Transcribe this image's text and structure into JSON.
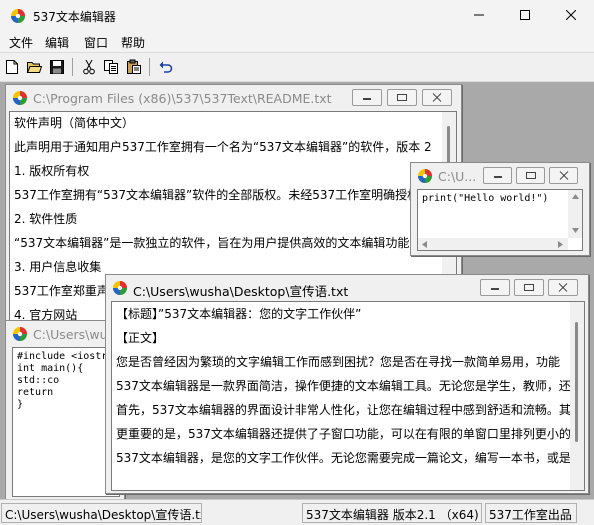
{
  "app": {
    "title": "537文本编辑器"
  },
  "menu": [
    "文件",
    "编辑",
    "窗口",
    "帮助"
  ],
  "toolbar": [
    "new-file-icon",
    "open-folder-icon",
    "save-icon",
    "cut-icon",
    "copy-icon",
    "paste-icon",
    "undo-icon"
  ],
  "windows": {
    "readme": {
      "title": "C:\\Program Files (x86)\\537\\537Text\\README.txt",
      "lines": [
        "软件声明（简体中文）",
        "此声明用于通知用户537工作室拥有一个名为“537文本编辑器”的软件，版本 2",
        "1. 版权所有权",
        "537工作室拥有“537文本编辑器”软件的全部版权。未经537工作室明确授权",
        "2. 软件性质",
        "“537文本编辑器”是一款独立的软件，旨在为用户提供高效的文本编辑功能",
        "3. 用户信息收集",
        "537工作室郑重声明",
        "4. 官方网站"
      ]
    },
    "hello": {
      "title": "C:\\U...",
      "lines": [
        "print(\"Hello world!\")"
      ]
    },
    "cpp": {
      "title": "C:\\Users\\wu",
      "lines": [
        "#include <iostr",
        "int main(){",
        "        std::co",
        "        return",
        "}"
      ]
    },
    "promo": {
      "title": "C:\\Users\\wusha\\Desktop\\宣传语.txt",
      "lines": [
        "【标题】”537文本编辑器：您的文字工作伙伴”",
        "【正文】",
        "您是否曾经因为繁琐的文字编辑工作而感到困扰？您是否在寻找一款简单易用，功能",
        "537文本编辑器是一款界面简洁，操作便捷的文本编辑工具。无论您是学生，教师，还",
        "首先，537文本编辑器的界面设计非常人性化，让您在编辑过程中感到舒适和流畅。其",
        "更重要的是，537文本编辑器还提供了子窗口功能，可以在有限的单窗口里排列更小的",
        "537文本编辑器，是您的文字工作伙伴。无论您需要完成一篇论文，编写一本书，或是"
      ]
    }
  },
  "status": {
    "path": "C:\\Users\\wusha\\Desktop\\宣传语.txt",
    "version": "537文本编辑器  版本2.1 （x64)",
    "publisher": "537工作室出品"
  }
}
